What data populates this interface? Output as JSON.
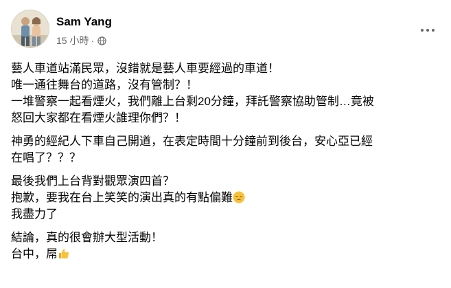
{
  "post": {
    "author": "Sam Yang",
    "time": "15 小時",
    "separator": "·",
    "privacy_icon": "globe-icon",
    "menu_icon": "more-horizontal-icon"
  },
  "content": {
    "paragraphs": [
      [
        "藝人車道站滿民眾，沒錯就是藝人車要經過的車道！",
        "唯一通往舞台的道路，沒有管制？！",
        "一堆警察一起看煙火，我們離上台剩20分鐘，拜託警察協助管制…竟被",
        "怒回大家都在看煙火誰理你們？！"
      ],
      [
        "神勇的經紀人下車自己開道，在表定時間十分鐘前到後台，安心亞已經",
        "在唱了？？？"
      ],
      [
        "最後我們上台背對觀眾演四首？",
        "抱歉，要我在台上笑笑的演出真的有點偏難",
        "我盡力了"
      ],
      [
        "結論，真的很會辦大型活動！",
        "台中，屌"
      ]
    ]
  },
  "emojis": {
    "pensive": "pensive-face-icon",
    "thumbs_up": "thumbs-up-icon"
  }
}
